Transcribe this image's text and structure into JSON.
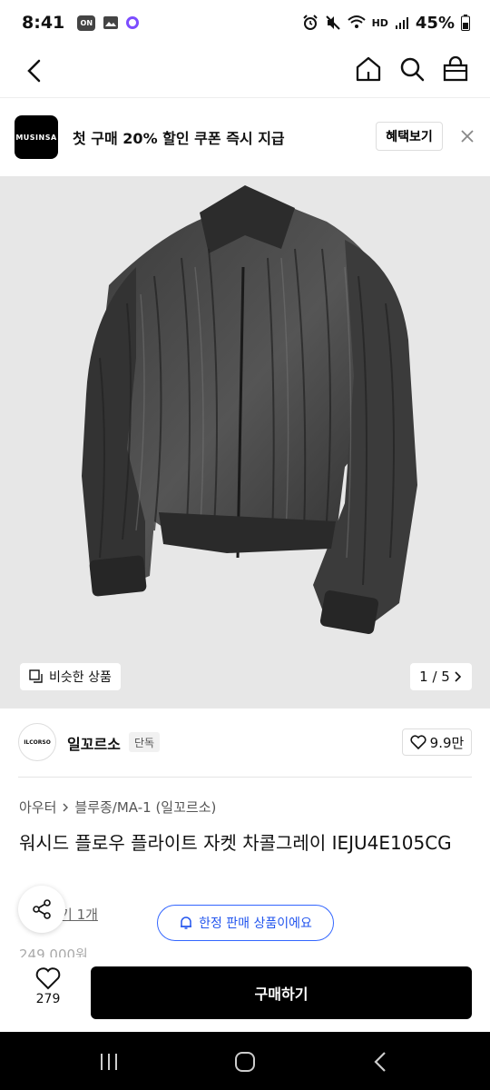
{
  "status_bar": {
    "time": "8:41",
    "badge": "ON",
    "hd_label": "HD",
    "battery": "45%"
  },
  "nav": {
    "icons": [
      "back-arrow-icon",
      "home-icon",
      "search-icon",
      "shopping-bag-icon"
    ]
  },
  "banner": {
    "logo_text": "MUSINSA",
    "text": "첫 구매 20% 할인 쿠폰 즉시 지급",
    "button_label": "혜택보기"
  },
  "image": {
    "similar_label": "비슷한 상품",
    "counter": "1 / 5"
  },
  "brand": {
    "logo_text": "ILCORSO",
    "name": "일꼬르소",
    "tag": "단독",
    "likes": "9.9만"
  },
  "breadcrumb": {
    "items": [
      "아우터",
      "블루종/MA-1 (일꼬르소)"
    ]
  },
  "product": {
    "title": "워시드 플로우 플라이트 자켓 차콜그레이 IEJU4E105CG",
    "review_link": "기 1개",
    "limited_label": "한정 판매 상품이에요",
    "price_partial": "249,000원"
  },
  "bottom": {
    "wish_count": "279",
    "buy_label": "구매하기"
  },
  "colors": {
    "accent_blue": "#3366ff",
    "buy_button": "#000000",
    "image_bg": "#e7e7e7"
  }
}
